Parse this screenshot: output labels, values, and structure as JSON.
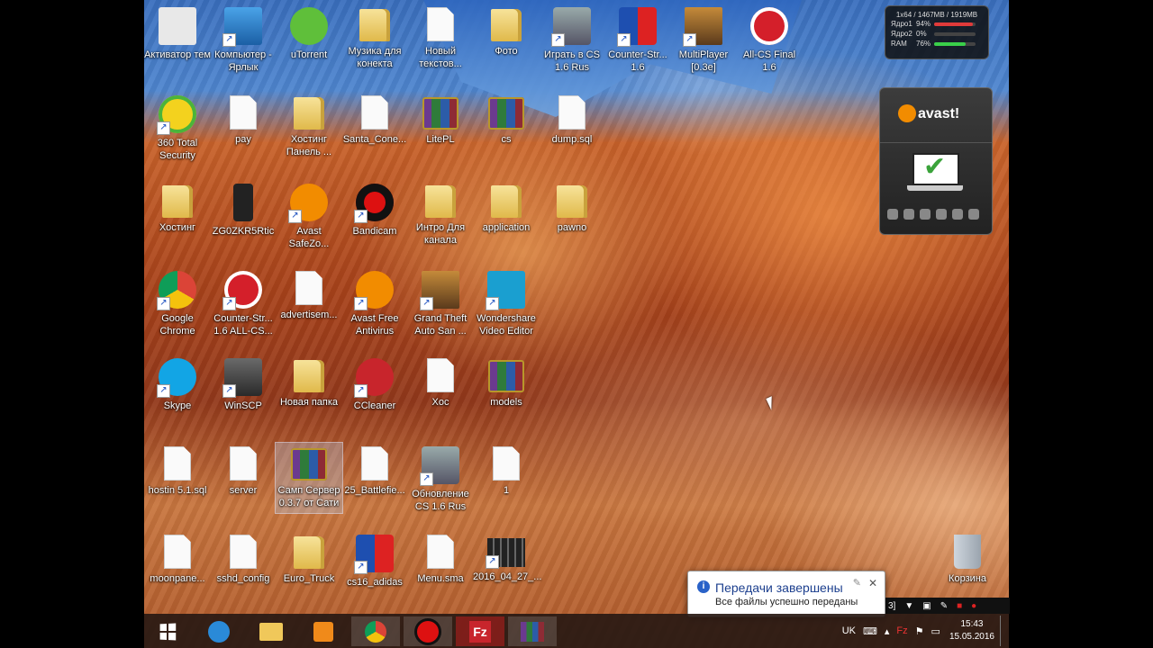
{
  "desktop": {
    "icons": [
      {
        "label": "Активатор тем",
        "kind": "app"
      },
      {
        "label": "Компьютер - Ярлык",
        "kind": "shortcut"
      },
      {
        "label": "uTorrent",
        "kind": "app"
      },
      {
        "label": "Музика для конекта",
        "kind": "folder"
      },
      {
        "label": "Новый текстов...",
        "kind": "file"
      },
      {
        "label": "Фото",
        "kind": "folder"
      },
      {
        "label": "Играть в CS 1.6 Rus",
        "kind": "shortcut"
      },
      {
        "label": "Counter-Str... 1.6",
        "kind": "shortcut"
      },
      {
        "label": "MultiPlayer [0.3e]",
        "kind": "shortcut"
      },
      {
        "label": "All-CS Final 1.6",
        "kind": "app"
      },
      {
        "label": "360 Total Security",
        "kind": "shortcut"
      },
      {
        "label": "pay",
        "kind": "file"
      },
      {
        "label": "Хостинг Панель ...",
        "kind": "folder"
      },
      {
        "label": "Santa_Cone...",
        "kind": "file"
      },
      {
        "label": "LitePL",
        "kind": "rar"
      },
      {
        "label": "cs",
        "kind": "rar"
      },
      {
        "label": "dump.sql",
        "kind": "file"
      },
      {
        "label": "Хостинг",
        "kind": "folder"
      },
      {
        "label": "ZG0ZKR5Rtic",
        "kind": "app"
      },
      {
        "label": "Avast SafeZo...",
        "kind": "shortcut"
      },
      {
        "label": "Bandicam",
        "kind": "shortcut"
      },
      {
        "label": "Интро Для канала",
        "kind": "folder"
      },
      {
        "label": "application",
        "kind": "folder"
      },
      {
        "label": "pawno",
        "kind": "folder"
      },
      {
        "label": "Google Chrome",
        "kind": "shortcut"
      },
      {
        "label": "Counter-Str... 1.6 ALL-CS...",
        "kind": "shortcut"
      },
      {
        "label": "advertisem...",
        "kind": "file"
      },
      {
        "label": "Avast Free Antivirus",
        "kind": "shortcut"
      },
      {
        "label": "Grand Theft Auto San ...",
        "kind": "shortcut"
      },
      {
        "label": "Wondershare Video Editor",
        "kind": "shortcut"
      },
      {
        "label": "Skype",
        "kind": "shortcut"
      },
      {
        "label": "WinSCP",
        "kind": "shortcut"
      },
      {
        "label": "Новая папка",
        "kind": "folder"
      },
      {
        "label": "CCleaner",
        "kind": "shortcut"
      },
      {
        "label": "Xoc",
        "kind": "file"
      },
      {
        "label": "models",
        "kind": "rar"
      },
      {
        "label": "hostin 5.1.sql",
        "kind": "file"
      },
      {
        "label": "server",
        "kind": "file"
      },
      {
        "label": "Самп Сервер 0.3.7 от Сати",
        "kind": "rar"
      },
      {
        "label": "25_Battlefie...",
        "kind": "file"
      },
      {
        "label": "Обновление CS 1.6 Rus",
        "kind": "shortcut"
      },
      {
        "label": "1",
        "kind": "file"
      },
      {
        "label": "moonpane...",
        "kind": "file"
      },
      {
        "label": "sshd_config",
        "kind": "file"
      },
      {
        "label": "Euro_Truck",
        "kind": "folder"
      },
      {
        "label": "cs16_adidas",
        "kind": "shortcut"
      },
      {
        "label": "Menu.sma",
        "kind": "file"
      },
      {
        "label": "2016_04_27_...",
        "kind": "shortcut"
      },
      {
        "label": "Корзина",
        "kind": "trash"
      }
    ]
  },
  "sysmon": {
    "header": "1x64 / 1467MB / 1919MB",
    "rows": [
      {
        "label": "Ядро1",
        "value": "94%",
        "level": 94,
        "color": "#e03a3a"
      },
      {
        "label": "Ядро2",
        "value": "0%",
        "level": 0,
        "color": "#e03a3a"
      },
      {
        "label": "RAM",
        "value": "76%",
        "level": 76,
        "color": "#3ad04a"
      }
    ]
  },
  "avast": {
    "logo": "avast!"
  },
  "notification": {
    "title": "Передачи завершены",
    "body": "Все файлы успешно переданы",
    "close": "✕",
    "pin": "✎"
  },
  "filezilla_bar": {
    "text": "3]"
  },
  "taskbar": {
    "apps": [
      "ie-icon",
      "explorer-icon",
      "media-player-icon",
      "chrome-icon",
      "bandicam-icon",
      "filezilla-icon",
      "winrar-icon"
    ],
    "language": "UK",
    "time": "15:43",
    "date": "15.05.2016"
  }
}
